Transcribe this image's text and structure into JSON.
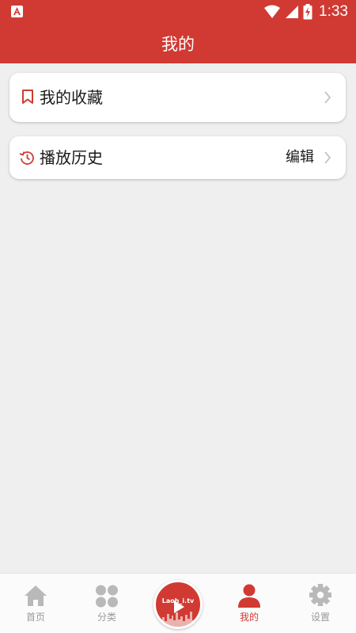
{
  "status_bar": {
    "time": "1:33"
  },
  "app_bar": {
    "title": "我的"
  },
  "menu": {
    "favorites": {
      "label": "我的收藏",
      "icon": "bookmark-icon"
    },
    "history": {
      "label": "播放历史",
      "action_label": "编辑",
      "icon": "history-icon"
    }
  },
  "bottom_nav": {
    "items": [
      {
        "label": "首页",
        "icon": "home-icon"
      },
      {
        "label": "分类",
        "icon": "category-icon"
      },
      {
        "label": "",
        "icon": "play-logo-icon",
        "logo_text": "Laoh_i.tv"
      },
      {
        "label": "我的",
        "icon": "user-icon"
      },
      {
        "label": "设置",
        "icon": "gear-icon"
      }
    ],
    "active_index": 3
  },
  "colors": {
    "accent": "#d03a33",
    "background": "#efefef",
    "inactive": "#9a9a9a"
  }
}
